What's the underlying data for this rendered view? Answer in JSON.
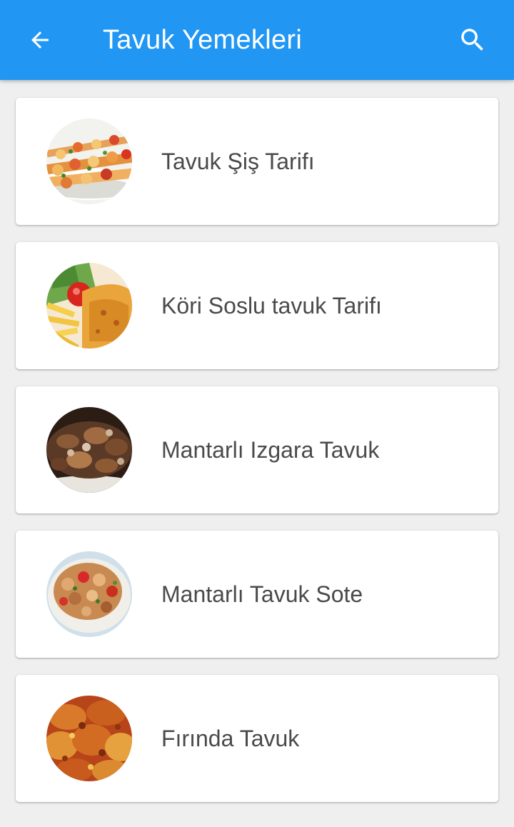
{
  "appbar": {
    "title": "Tavuk Yemekleri",
    "back_icon": "arrow-back-icon",
    "search_icon": "search-icon",
    "background_color": "#2196f3"
  },
  "recipes": [
    {
      "title": "Tavuk Şiş Tarifı"
    },
    {
      "title": "Köri Soslu tavuk Tarifı"
    },
    {
      "title": "Mantarlı Izgara Tavuk"
    },
    {
      "title": "Mantarlı Tavuk Sote"
    },
    {
      "title": "Fırında Tavuk"
    }
  ]
}
